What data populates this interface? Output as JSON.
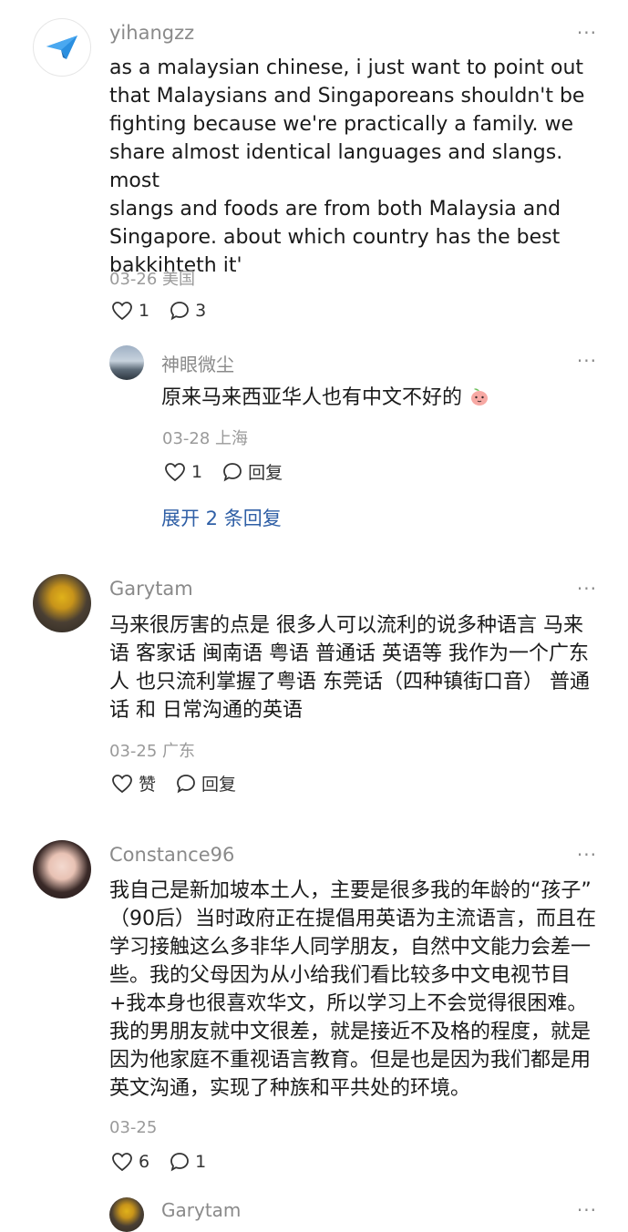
{
  "comments": [
    {
      "user": "yihangzz",
      "lines": [
        "as a malaysian chinese, i just want to point out",
        "that Malaysians and Singaporeans shouldn't be",
        "fighting because we're practically a family. we",
        "share almost identical languages and slangs. most",
        "slangs and foods are from both Malaysia and",
        "Singapore. about which country has the best",
        "bakkihteth it'"
      ],
      "meta": "03-26 美国",
      "likes": "1",
      "replies": "3",
      "reply": {
        "user": "神眼微尘",
        "text": "原来马来西亚华人也有中文不好的",
        "meta": "03-28 上海",
        "likes": "1",
        "reply_label": "回复"
      },
      "expand": "展开 2 条回复"
    },
    {
      "user": "Garytam",
      "lines": [
        "马来很厉害的点是 很多人可以流利的说多种语言 马来",
        "语 客家话 闽南语 粤语 普通话 英语等 我作为一个广东",
        "人 也只流利掌握了粤语 东莞话（四种镇街口音） 普通",
        "话 和 日常沟通的英语"
      ],
      "meta": "03-25 广东",
      "like_label": "赞",
      "reply_label": "回复"
    },
    {
      "user": "Constance96",
      "lines": [
        "我自己是新加坡本土人，主要是很多我的年龄的“孩子”",
        "（90后）当时政府正在提倡用英语为主流语言，而且在",
        "学习接触这么多非华人同学朋友，自然中文能力会差一",
        "些。我的父母因为从小给我们看比较多中文电视节目",
        "+我本身也很喜欢华文，所以学习上不会觉得很困难。",
        "我的男朋友就中文很差，就是接近不及格的程度，就是",
        "因为他家庭不重视语言教育。但是也是因为我们都是用",
        "英文沟通，实现了种族和平共处的环境。"
      ],
      "meta": "03-25",
      "likes": "6",
      "replies": "1",
      "reply": {
        "user": "Garytam"
      }
    }
  ],
  "more_label": "···",
  "colors": {
    "link": "#2f5fa6",
    "meta": "#9a9a9a",
    "username": "#8a8a8a"
  },
  "icons": [
    "paper-plane-icon",
    "heart-outline-icon",
    "comment-bubble-icon",
    "peach-emoji-icon",
    "more-icon"
  ]
}
